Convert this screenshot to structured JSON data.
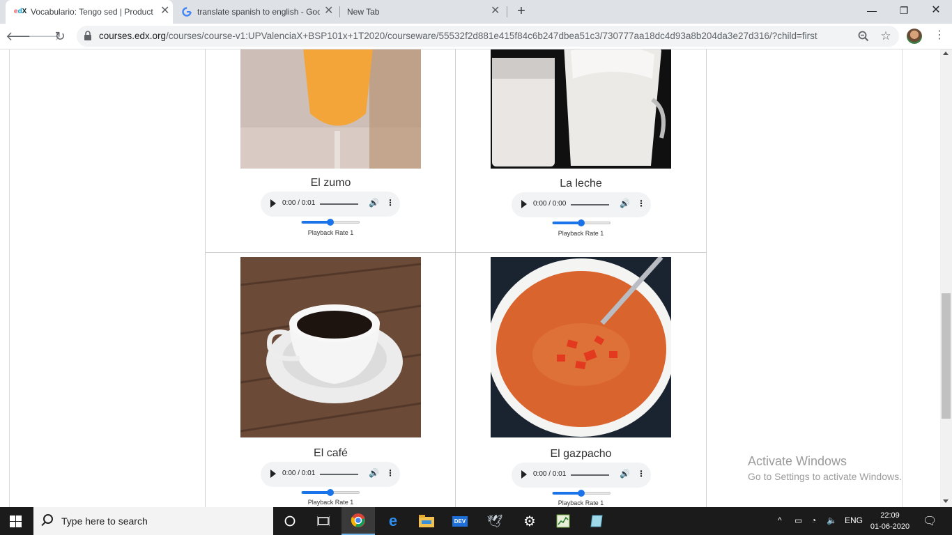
{
  "browser": {
    "tabs": [
      {
        "title": "Vocabulario: Tengo sed | Product",
        "favicon": "edx-icon"
      },
      {
        "title": "translate spanish to english - Goo",
        "favicon": "google-icon"
      },
      {
        "title": "New Tab",
        "favicon": "none"
      }
    ],
    "url_host": "courses.edx.org",
    "url_path": "/courses/course-v1:UPValenciaX+BSP101x+1T2020/courseware/55532f2d881e415f84c6b247dbea51c3/730777aa18dc4d93a8b204da3e27d316/?child=first"
  },
  "items": [
    {
      "caption": "El zumo",
      "time": "0:00 / 0:01",
      "rate_label": "Playback Rate 1",
      "rate_fraction": 0.5
    },
    {
      "caption": "La leche",
      "time": "0:00 / 0:00",
      "rate_label": "Playback Rate 1",
      "rate_fraction": 0.5
    },
    {
      "caption": "El café",
      "time": "0:00 / 0:01",
      "rate_label": "Playback Rate 1",
      "rate_fraction": 0.5
    },
    {
      "caption": "El gazpacho",
      "time": "0:00 / 0:01",
      "rate_label": "Playback Rate 1",
      "rate_fraction": 0.5
    }
  ],
  "watermark": {
    "line1": "Activate Windows",
    "line2": "Go to Settings to activate Windows."
  },
  "taskbar": {
    "search_placeholder": "Type here to search",
    "language": "ENG",
    "time": "22:09",
    "date": "01-06-2020"
  },
  "colors": {
    "accent": "#1a73e8",
    "taskbar": "#1b1b1b"
  }
}
